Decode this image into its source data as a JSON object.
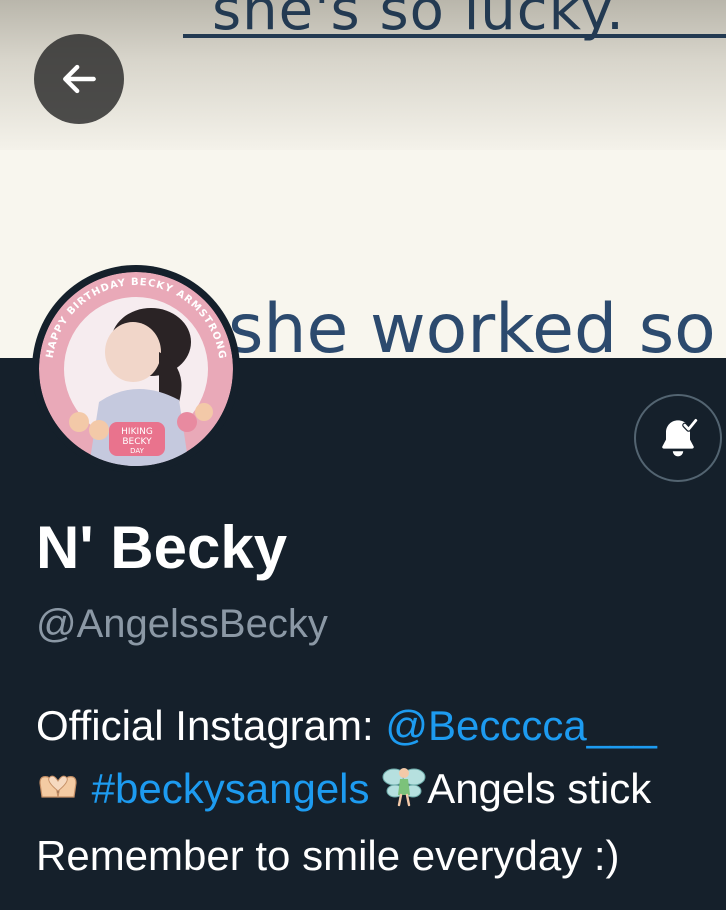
{
  "banner": {
    "text_line1": "she's so lucky.",
    "text_line2": "she worked so h"
  },
  "nav": {
    "back_icon": "arrow-left-icon"
  },
  "profile": {
    "display_name": "N' Becky",
    "handle": "@AngelssBecky",
    "notification_icon": "bell-subscribed-icon",
    "avatar_text": {
      "ring": "HAPPY BIRTHDAY BECKY ARMSTRONG",
      "badge_line1": "HIKING",
      "badge_line2": "BECKY",
      "badge_line3": "DAY"
    }
  },
  "bio": {
    "line1_prefix": "Official Instagram: ",
    "instagram_handle": "@Becccca___",
    "line2_hashtag": "#beckysangels",
    "line2_suffix": "Angels stick",
    "line3": "Remember to smile everyday :)",
    "emoji_heart_hands": "heart-hands-emoji",
    "emoji_fairy": "fairy-emoji"
  },
  "colors": {
    "background": "#15202b",
    "link": "#1d9bf0",
    "secondary_text": "#8b98a5",
    "banner_bg": "#f8f6ee",
    "banner_text": "#233a52"
  }
}
